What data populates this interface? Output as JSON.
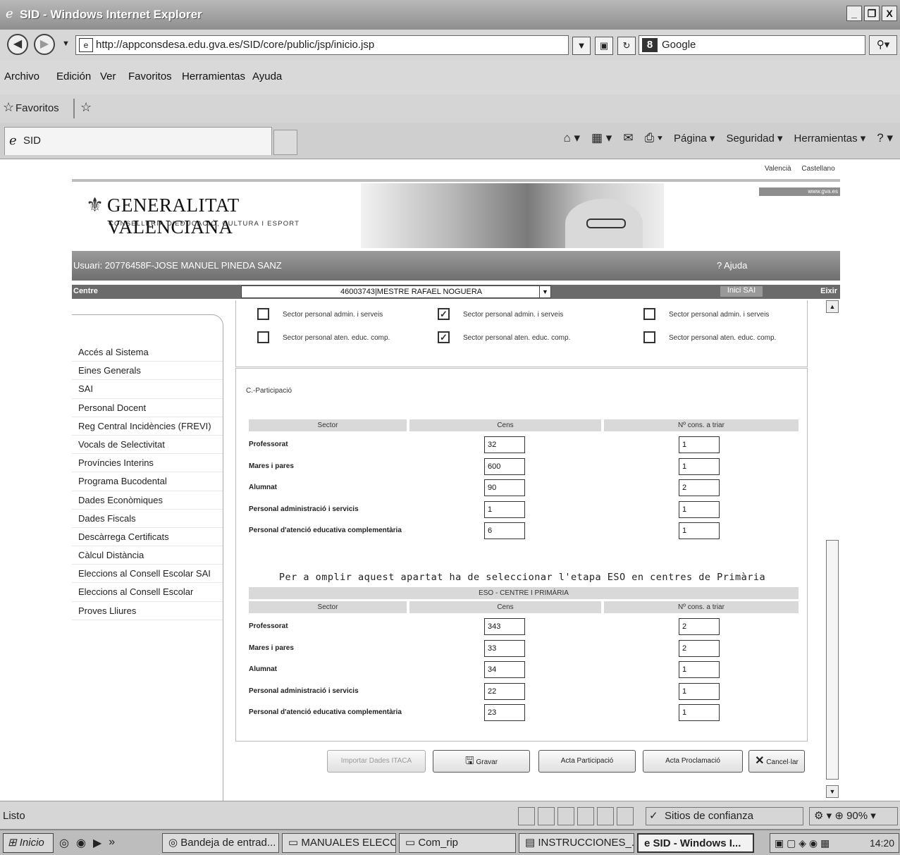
{
  "window": {
    "title": "SID - Windows Internet Explorer",
    "min": "_",
    "max": "̅",
    "close": "X"
  },
  "address_bar": {
    "url": "http://appconsdesa.edu.gva.es/SID/core/public/jsp/inicio.jsp",
    "search_provider": "Google"
  },
  "menu": [
    "Archivo",
    "Edición",
    "Ver",
    "Favoritos",
    "Herramientas",
    "Ayuda"
  ],
  "favorites_label": "Favoritos",
  "tab_title": "SID",
  "command_bar": {
    "page": "Página ▾",
    "security": "Seguridad ▾",
    "tools": "Herramientas ▾"
  },
  "page": {
    "languages": [
      "Valencià",
      "Castellano"
    ],
    "logo_name": "GENERALITAT VALENCIANA",
    "logo_sub": "CONSELLERIA D'EDUCACIÓ, CULTURA I ESPORT",
    "banner_right": "www.gva.es",
    "user_line": "Usuari: 20776458F-JOSE MANUEL PINEDA SANZ",
    "help_link": "Ajuda",
    "centre_label": "Centre",
    "centre_selected": "46003743|MESTRE RAFAEL NOGUERA",
    "inici_link": "Inici SAI",
    "eixir_link": "Eixir",
    "sidebar": [
      "Accés al Sistema",
      "Eines Generals",
      "SAI",
      "Personal Docent",
      "Reg Central Incidències (FREVI)",
      "Vocals de Selectivitat",
      "Províncies Interins",
      "Programa Bucodental",
      "Dades Econòmiques",
      "Dades Fiscals",
      "Descàrrega Certificats",
      "Càlcul Distància",
      "Eleccions al Consell Escolar SAI",
      "Eleccions al Consell Escolar",
      "Proves Lliures"
    ],
    "checkboxes": [
      {
        "label": "Sector personal admin. i serveis",
        "checked": false
      },
      {
        "label": "Sector personal admin. i serveis",
        "checked": true
      },
      {
        "label": "Sector personal admin. i serveis",
        "checked": false
      },
      {
        "label": "Sector personal aten. educ. comp.",
        "checked": false
      },
      {
        "label": "Sector personal aten. educ. comp.",
        "checked": true
      },
      {
        "label": "Sector personal aten. educ. comp.",
        "checked": false
      }
    ],
    "section_title": "C.-Participació",
    "headers": {
      "sector": "Sector",
      "cens": "Cens",
      "cons": "Nº cons. a triar"
    },
    "table1": [
      {
        "sector": "Professorat",
        "cens": "32",
        "cons": "1"
      },
      {
        "sector": "Mares i pares",
        "cens": "600",
        "cons": "1"
      },
      {
        "sector": "Alumnat",
        "cens": "90",
        "cons": "2"
      },
      {
        "sector": "Personal administració i servicis",
        "cens": "1",
        "cons": "1"
      },
      {
        "sector": "Personal d'atenció educativa complementària",
        "cens": "6",
        "cons": "1"
      }
    ],
    "notice": "Per a omplir aquest apartat ha de seleccionar l'etapa ESO en centres de Primària",
    "eso_header": "ESO - CENTRE I PRIMÀRIA",
    "table2": [
      {
        "sector": "Professorat",
        "cens": "343",
        "cons": "2"
      },
      {
        "sector": "Mares i pares",
        "cens": "33",
        "cons": "2"
      },
      {
        "sector": "Alumnat",
        "cens": "34",
        "cons": "1"
      },
      {
        "sector": "Personal administració i servicis",
        "cens": "22",
        "cons": "1"
      },
      {
        "sector": "Personal d'atenció educativa complementària",
        "cens": "23",
        "cons": "1"
      }
    ],
    "buttons": {
      "import": "Importar Dades ITACA",
      "save": "Gravar",
      "acta_part": "Acta Participació",
      "acta_procl": "Acta Proclamació",
      "cancel": "Cancel·lar"
    }
  },
  "status": {
    "text": "Listo",
    "zone": "Sitios de confianza",
    "zoom": "90%"
  },
  "taskbar": {
    "start": "Inicio",
    "items": [
      "Bandeja de entrad...",
      "MANUALES ELECONS",
      "Com_rip",
      "INSTRUCCIONES_...",
      "SID - Windows I..."
    ],
    "clock": "14:20"
  }
}
